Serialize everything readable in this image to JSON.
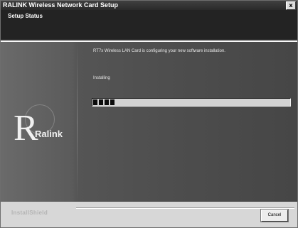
{
  "window": {
    "title": "RALINK Wireless Network Card Setup",
    "close_glyph": "x"
  },
  "header": {
    "heading": "Setup Status"
  },
  "logo": {
    "letter": "R",
    "word": "Ralink"
  },
  "main": {
    "message": "RT7x Wireless LAN Card is configuring your new software installation.",
    "status": "Installing",
    "progress_fraction": 0.11
  },
  "footer": {
    "brand": "InstallShield",
    "cancel_label": "Cancel"
  },
  "colors": {
    "header_bg": "#232323",
    "panel_bg": "#4d4d4d",
    "progress_fill": "#0c0c0c"
  }
}
